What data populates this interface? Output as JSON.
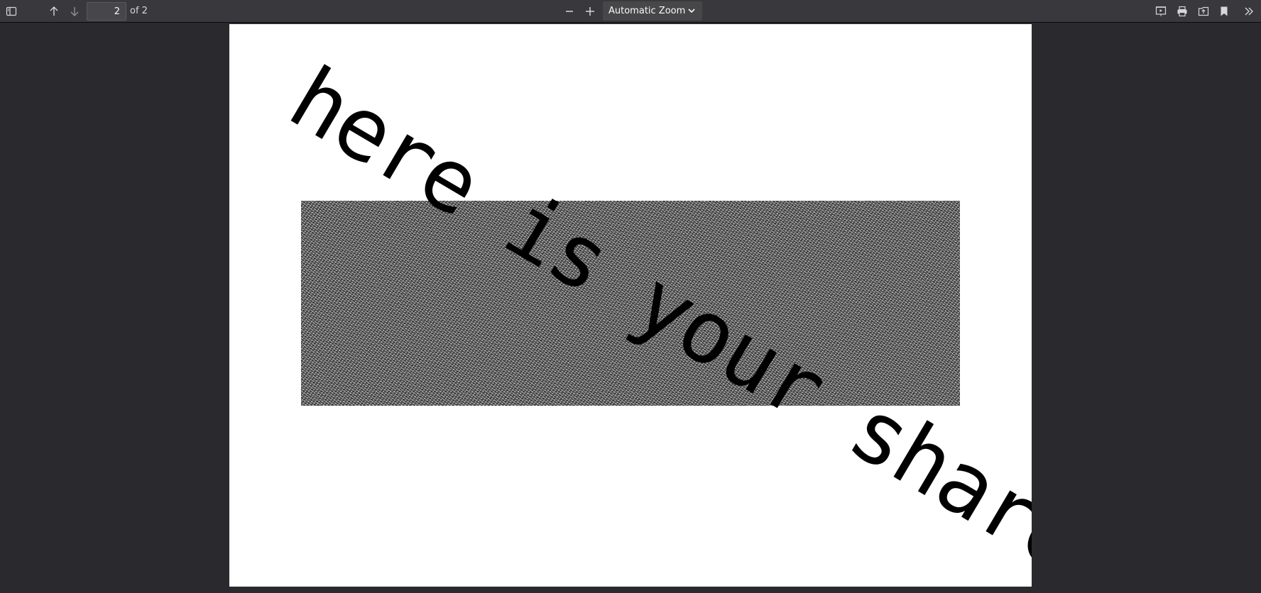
{
  "toolbar": {
    "page_number": "2",
    "page_count": "of 2",
    "zoom": "Automatic Zoom",
    "icons": {
      "sidebar_toggle": "sidebar-toggle-icon",
      "prev_page": "arrow-up-icon",
      "next_page": "arrow-down-icon",
      "zoom_out": "minus-icon",
      "zoom_in": "plus-icon",
      "presentation": "presentation-mode-icon",
      "print": "print-icon",
      "open": "open-file-icon",
      "bookmark": "bookmark-icon",
      "tools": "double-chevron-right-icon"
    }
  },
  "document": {
    "overlay_text": "here is your share"
  },
  "colors": {
    "toolbar_bg": "#38383d",
    "viewer_bg": "#2a2a2e",
    "page_bg": "#ffffff",
    "text": "#000000"
  }
}
